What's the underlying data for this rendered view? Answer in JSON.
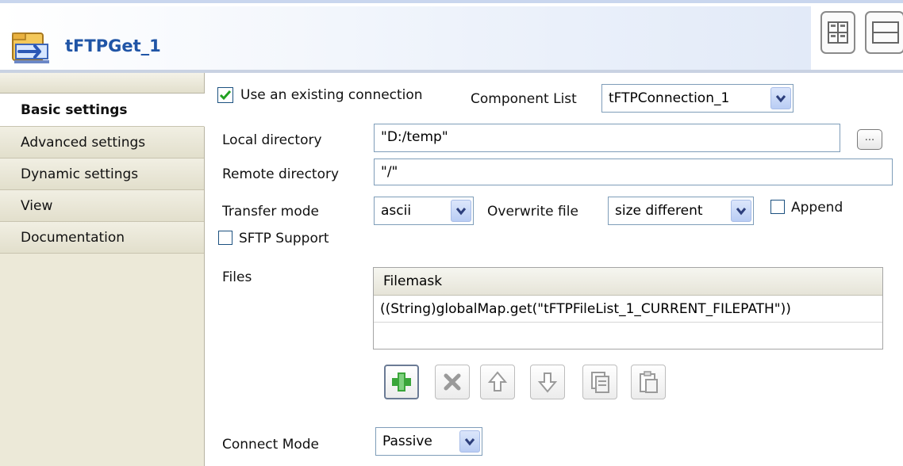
{
  "header": {
    "title": "tFTPGet_1",
    "icon": "ftp-get-component-icon",
    "view_buttons": [
      "grid-view-icon",
      "list-view-icon"
    ]
  },
  "sidebar": {
    "items": [
      {
        "label": "Basic settings",
        "active": true
      },
      {
        "label": "Advanced settings",
        "active": false
      },
      {
        "label": "Dynamic settings",
        "active": false
      },
      {
        "label": "View",
        "active": false
      },
      {
        "label": "Documentation",
        "active": false
      }
    ]
  },
  "basic": {
    "use_existing_connection": {
      "label": "Use an existing connection",
      "checked": true
    },
    "component_list": {
      "label": "Component List",
      "value": "tFTPConnection_1"
    },
    "local_directory": {
      "label": "Local directory",
      "value": "\"D:/temp\"",
      "button": "..."
    },
    "remote_directory": {
      "label": "Remote directory",
      "value": "\"/\""
    },
    "transfer_mode": {
      "label": "Transfer mode",
      "value": "ascii"
    },
    "overwrite_file": {
      "label": "Overwrite file",
      "value": "size different"
    },
    "append": {
      "label": "Append",
      "checked": false
    },
    "sftp_support": {
      "label": "SFTP Support",
      "checked": false
    },
    "files": {
      "label": "Files",
      "columns": [
        "Filemask"
      ],
      "rows": [
        "((String)globalMap.get(\"tFTPFileList_1_CURRENT_FILEPATH\"))"
      ],
      "toolbar": [
        "add-icon",
        "remove-icon",
        "move-up-icon",
        "move-down-icon",
        "copy-icon",
        "paste-icon"
      ]
    },
    "connect_mode": {
      "label": "Connect Mode",
      "value": "Passive"
    }
  },
  "colors": {
    "title": "#2055a6",
    "sidebar_bg": "#ece9d8",
    "check_green": "#21a121",
    "add_green": "#3aa53a"
  }
}
